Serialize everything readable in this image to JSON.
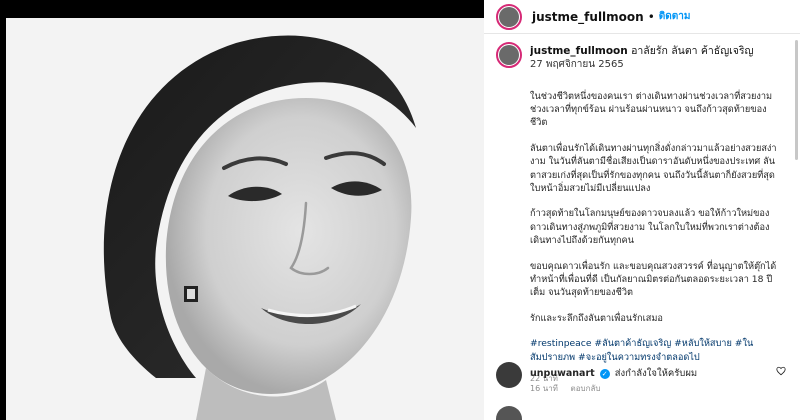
{
  "post": {
    "username": "justme_fullmoon",
    "follow_label": "ติดตาม",
    "separator": "•",
    "caption_title": "อาลัยรัก ลันตา ค้าธัญเจริญ",
    "date": "27 พฤศจิกายน 2565",
    "paragraphs": [
      "ในช่วงชีวิตหนึ่งของคนเรา ต่างเดินทางผ่านช่วงเวลาที่สวยงาม ช่วงเวลาที่ทุกข์ร้อน ผ่านร้อนผ่านหนาว จนถึงก้าวสุดท้ายของชีวิต",
      "ลันตาเพื่อนรักได้เดินทางผ่านทุกสิ่งดั่งกล่าวมาแล้วอย่างสวยสง่างาม ในวันที่ลันตามีชื่อเสียงเป็นดาราอันดับหนึ่งของประเทศ ลันตาสวยเก่งที่สุดเป็นที่รักของทุกคน จนถึงวันนี้ลันตาก็ยังสวยที่สุด ใบหน้าอิ่มสวยไม่มีเปลี่ยนแปลง",
      "ก้าวสุดท้ายในโลกมนุษย์ของดาวจบลงแล้ว ขอให้ก้าวใหม่ของดาวเดินทางสู่ภพภูมิที่สวยงาม ในโลกใบใหม่ที่พวกเราต่างต้องเดินทางไปถึงด้วยกันทุกคน",
      "ขอบคุณดาวเพื่อนรัก และขอบคุณสวงสวรรค์ ที่อนุญาตให้ตุ๊กได้ทำหน้าที่เพื่อนที่ดี เป็นกัลยาณมิตรต่อกันตลอดระยะเวลา 18 ปีเต็ม จนวันสุดท้ายของชีวิต",
      "รักและระลึกถึงลันตาเพื่อนรักเสมอ"
    ],
    "hashtags": "#restinpeace #ลันตาค้าธัญเจริญ #หลับให้สบาย #ในสัมปรายภพ #จะอยู่ในความทรงจำตลอดไป",
    "time_ago": "22 นาที"
  },
  "comments": [
    {
      "username": "unpuwanart",
      "text": "ส่งกำลังใจให้ครับผม",
      "time": "16 นาที",
      "reply_label": "ตอบกลับ"
    }
  ],
  "colors": {
    "accent": "#0095f6",
    "hashtag": "#00376b",
    "ring": "#d62976"
  }
}
